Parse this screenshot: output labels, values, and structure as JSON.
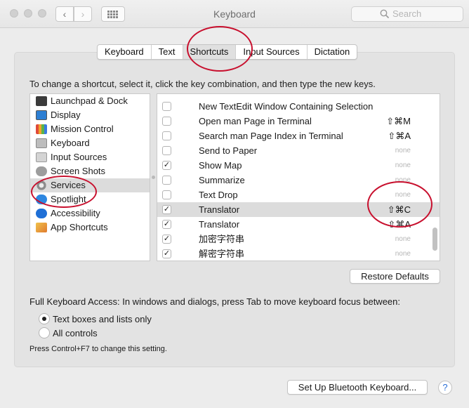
{
  "window": {
    "title": "Keyboard"
  },
  "search": {
    "placeholder": "Search"
  },
  "tabs": [
    "Keyboard",
    "Text",
    "Shortcuts",
    "Input Sources",
    "Dictation"
  ],
  "instructions": "To change a shortcut, select it, click the key combination, and then type the new keys.",
  "categories": [
    {
      "label": "Launchpad & Dock",
      "icon": "launchpad-dock-icon"
    },
    {
      "label": "Display",
      "icon": "display-icon"
    },
    {
      "label": "Mission Control",
      "icon": "mission-control-icon"
    },
    {
      "label": "Keyboard",
      "icon": "keyboard-icon"
    },
    {
      "label": "Input Sources",
      "icon": "input-sources-icon"
    },
    {
      "label": "Screen Shots",
      "icon": "screenshots-icon"
    },
    {
      "label": "Services",
      "icon": "gear-icon",
      "selected": true
    },
    {
      "label": "Spotlight",
      "icon": "spotlight-icon"
    },
    {
      "label": "Accessibility",
      "icon": "accessibility-icon"
    },
    {
      "label": "App Shortcuts",
      "icon": "app-shortcuts-icon"
    }
  ],
  "shortcuts": [
    {
      "name": "New TextEdit Window Containing Selection",
      "checked": false,
      "key": ""
    },
    {
      "name": "Open man Page in Terminal",
      "checked": false,
      "key": "⇧⌘M"
    },
    {
      "name": "Search man Page Index in Terminal",
      "checked": false,
      "key": "⇧⌘A"
    },
    {
      "name": "Send to Paper",
      "checked": false,
      "key": "none"
    },
    {
      "name": "Show Map",
      "checked": true,
      "key": "none"
    },
    {
      "name": "Summarize",
      "checked": false,
      "key": "none"
    },
    {
      "name": "Text Drop",
      "checked": false,
      "key": "none"
    },
    {
      "name": "Translator",
      "checked": true,
      "key": "⇧⌘C",
      "selected": true
    },
    {
      "name": "Translator",
      "checked": true,
      "key": "⇧⌘A"
    },
    {
      "name": "加密字符串",
      "checked": true,
      "key": "none"
    },
    {
      "name": "解密字符串",
      "checked": true,
      "key": "none"
    }
  ],
  "buttons": {
    "restore": "Restore Defaults",
    "bluetooth": "Set Up Bluetooth Keyboard...",
    "help": "?"
  },
  "keyboard_access": {
    "label": "Full Keyboard Access: In windows and dialogs, press Tab to move keyboard focus between:",
    "options": [
      "Text boxes and lists only",
      "All controls"
    ],
    "selected": 0,
    "hint": "Press Control+F7 to change this setting."
  },
  "colors": {
    "annotation": "#c8102e",
    "selection": "#dcdcdc",
    "help_accent": "#2a6fd6"
  }
}
